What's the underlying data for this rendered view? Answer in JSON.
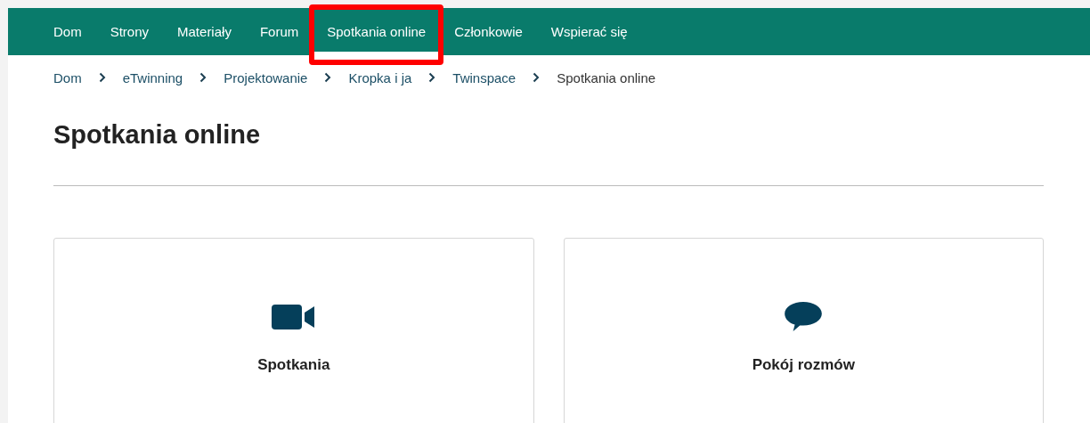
{
  "nav": {
    "items": [
      {
        "label": "Dom",
        "selected": false,
        "highlighted": false
      },
      {
        "label": "Strony",
        "selected": false,
        "highlighted": false
      },
      {
        "label": "Materiały",
        "selected": false,
        "highlighted": false
      },
      {
        "label": "Forum",
        "selected": false,
        "highlighted": false
      },
      {
        "label": "Spotkania online",
        "selected": true,
        "highlighted": true
      },
      {
        "label": "Członkowie",
        "selected": false,
        "highlighted": false
      },
      {
        "label": "Wspierać się",
        "selected": false,
        "highlighted": false
      }
    ]
  },
  "breadcrumb": {
    "links": [
      "Dom",
      "eTwinning",
      "Projektowanie",
      "Kropka i ja",
      "Twinspace"
    ],
    "current": "Spotkania online"
  },
  "page_title": "Spotkania online",
  "cards": [
    {
      "kind": "video",
      "label": "Spotkania"
    },
    {
      "kind": "chat",
      "label": "Pokój rozmów"
    }
  ]
}
